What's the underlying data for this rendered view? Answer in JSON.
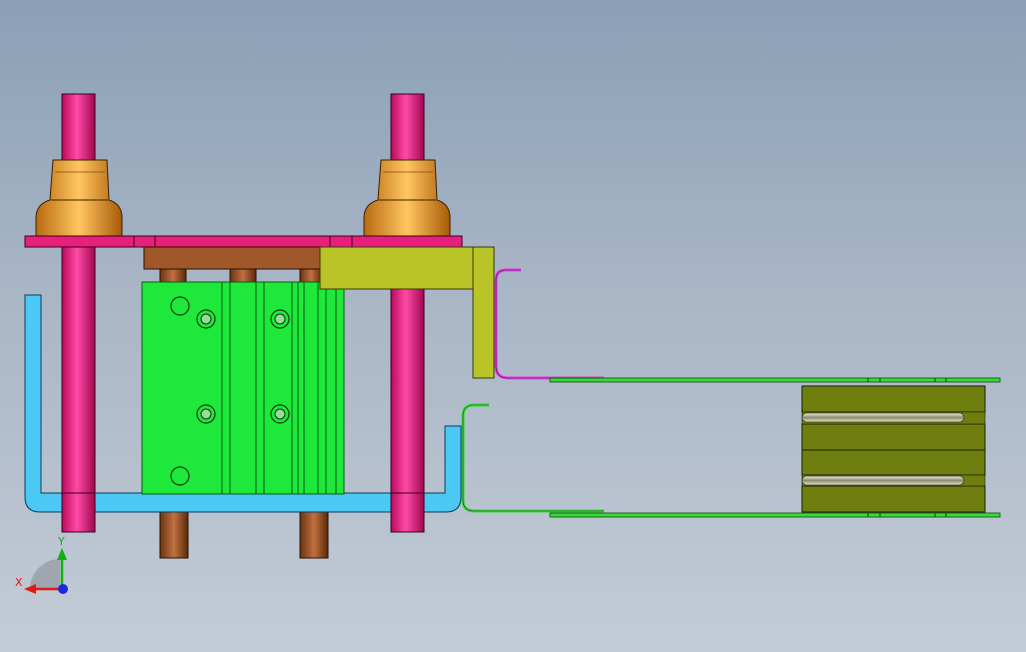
{
  "viewport": {
    "background_top": "#8a9fb6",
    "background_bottom": "#c3cbd6"
  },
  "triad": {
    "x_label": "X",
    "y_label": "Y",
    "x_color": "#e01818",
    "y_color": "#10b010",
    "z_color": "#1a2ad8"
  },
  "colors": {
    "guide_rod": "#e0187a",
    "bushing": "#e8a030",
    "top_plate": "#e8207c",
    "mount_block": "#a0582a",
    "cylinder_body": "#1ee83a",
    "cylinder_edge": "#0a5a10",
    "bracket_yellow": "#b8c428",
    "tray_blue": "#4cc8f4",
    "magenta_strip": "#e040e0",
    "green_strip": "#3ad83a",
    "stack_block": "#6e7f10",
    "spring": "#d0d0a8"
  }
}
